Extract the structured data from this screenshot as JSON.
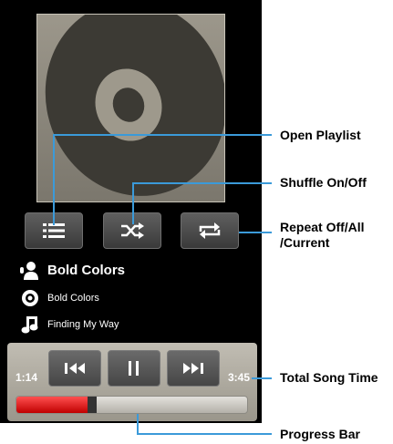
{
  "artist": "Bold Colors",
  "album": "Bold Colors",
  "song": "Finding My Way",
  "elapsed_time": "1:14",
  "total_time": "3:45",
  "progress_fraction": 0.33,
  "callouts": {
    "open_playlist": "Open Playlist",
    "shuffle": "Shuffle On/Off",
    "repeat_line1": "Repeat Off/All",
    "repeat_line2": "/Current",
    "total_song_time": "Total Song Time",
    "progress_bar": "Progress Bar"
  },
  "colors": {
    "callout_line": "#3b9ad9",
    "progress_fill": "#d90f0f"
  }
}
